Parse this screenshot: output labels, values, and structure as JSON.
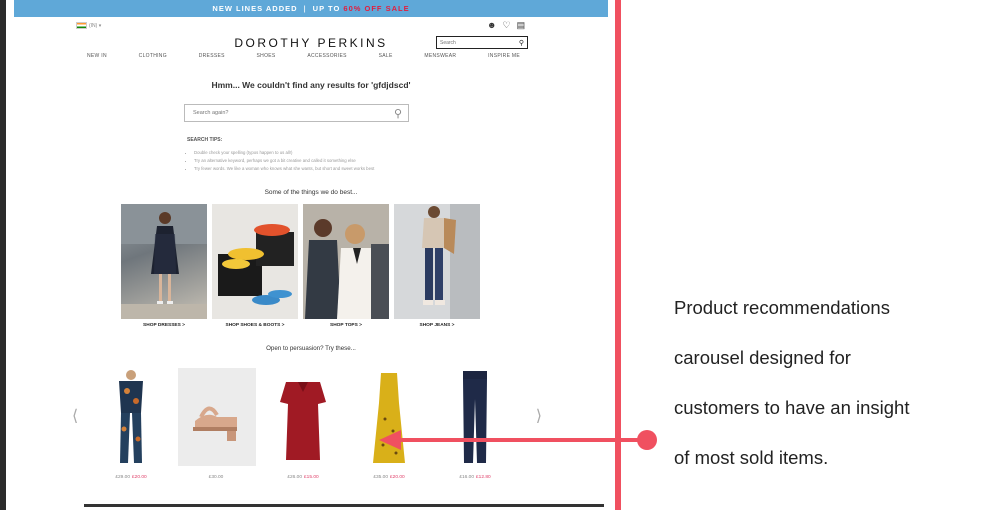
{
  "promo": {
    "left": "NEW LINES ADDED",
    "separator": "|",
    "right_prefix": "UP TO",
    "right_sale": "60% OFF SALE"
  },
  "header": {
    "country_code": "(IN) ▾",
    "logo": "DOROTHY PERKINS",
    "search_placeholder": "Search",
    "icons": [
      "account-icon",
      "heart-icon",
      "bag-icon"
    ]
  },
  "nav": [
    "NEW IN",
    "CLOTHING",
    "DRESSES",
    "SHOES",
    "ACCESSORIES",
    "SALE",
    "MENSWEAR",
    "INSPIRE ME"
  ],
  "results": {
    "message": "Hmm... We couldn't find any results for 'gfdjdscd'",
    "search_again_placeholder": "Search again?"
  },
  "tips": {
    "title": "SEARCH TIPS:",
    "items": [
      "Double check your spelling (typos happen to us all!)",
      "Try an alternative keyword, perhaps we got a bit creative and called it something else",
      "Try fewer words. We like a woman who knows what she wants, but short and sweet works best"
    ]
  },
  "best": {
    "heading": "Some of the things we do best...",
    "tiles": [
      {
        "label": "SHOP DRESSES >"
      },
      {
        "label": "SHOP SHOES & BOOTS >"
      },
      {
        "label": "SHOP TOPS >"
      },
      {
        "label": "SHOP JEANS >"
      }
    ]
  },
  "recommendations": {
    "heading": "Open to persuasion? Try these...",
    "prev_icon": "chevron-left-icon",
    "next_icon": "chevron-right-icon",
    "products": [
      {
        "was": "£29.00",
        "now": "£20.00"
      },
      {
        "was": "£30.00",
        "now": ""
      },
      {
        "was": "£26.00",
        "now": "£15.00"
      },
      {
        "was": "£35.00",
        "now": "£20.00"
      },
      {
        "was": "£16.00",
        "now": "£12.80"
      }
    ]
  },
  "annotation": {
    "lines": [
      "Product recommendations",
      "carousel designed for",
      "customers to have an insight",
      "of most sold items."
    ]
  },
  "colors": {
    "accent": "#f05060",
    "promo_bar": "#5fa8d8",
    "sale_text": "#e02040",
    "price_now": "#e0406a"
  }
}
